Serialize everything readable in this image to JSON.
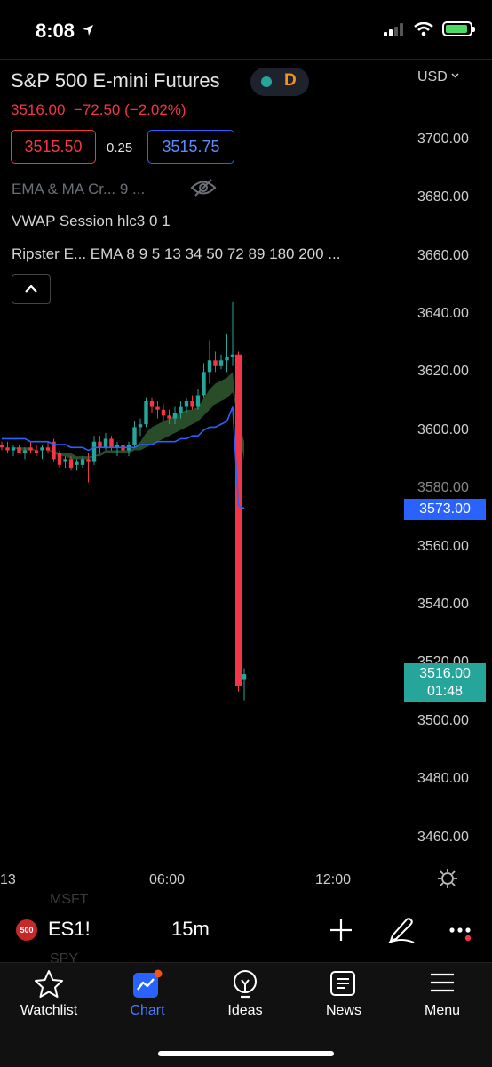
{
  "status": {
    "time": "8:08"
  },
  "header": {
    "symbol": "S&P 500 E-mini Futures",
    "interval_badge": "D",
    "currency": "USD",
    "last_price": "3516.00",
    "change": "−72.50 (−2.02%)",
    "bid": "3515.50",
    "spread": "0.25",
    "ask": "3515.75"
  },
  "indicators": [
    {
      "label": "EMA & MA Cr...   9 ..."
    },
    {
      "label": "VWAP Session hlc3 0 1"
    },
    {
      "label": "Ripster E...   EMA 8 9 5 13 34 50 72 89 180 200 ..."
    }
  ],
  "axis": {
    "y_ticks": [
      "3700.00",
      "3680.00",
      "3660.00",
      "3640.00",
      "3620.00",
      "3600.00",
      "3580.00",
      "3560.00",
      "3540.00",
      "3520.00",
      "3500.00",
      "3480.00",
      "3460.00"
    ],
    "x_ticks": [
      "13",
      "06:00",
      "12:00"
    ],
    "vwap_tag": "3573.00",
    "price_tag": "3516.00",
    "countdown": "01:48"
  },
  "toolbar": {
    "badge": "500",
    "ticker": "ES1!",
    "interval": "15m",
    "ghost_above": "MSFT",
    "ghost_below": "SPY"
  },
  "tabs": [
    {
      "id": "watchlist",
      "label": "Watchlist"
    },
    {
      "id": "chart",
      "label": "Chart"
    },
    {
      "id": "ideas",
      "label": "Ideas"
    },
    {
      "id": "news",
      "label": "News"
    },
    {
      "id": "menu",
      "label": "Menu"
    }
  ],
  "colors": {
    "up": "#26a69a",
    "down": "#f23645",
    "vwap": "#2962ff",
    "accent": "#2962ff"
  },
  "chart_data": {
    "type": "candlestick",
    "ylim": [
      3450,
      3710
    ],
    "y_ticks": [
      3700,
      3680,
      3660,
      3640,
      3620,
      3600,
      3580,
      3560,
      3540,
      3520,
      3500,
      3480,
      3460
    ],
    "x_ticks": [
      "13",
      "06:00",
      "12:00"
    ],
    "candles": [
      {
        "o": 3595,
        "h": 3596,
        "l": 3593,
        "c": 3594
      },
      {
        "o": 3594,
        "h": 3596,
        "l": 3592,
        "c": 3593
      },
      {
        "o": 3593,
        "h": 3595,
        "l": 3591,
        "c": 3594
      },
      {
        "o": 3594,
        "h": 3595,
        "l": 3592,
        "c": 3592
      },
      {
        "o": 3592,
        "h": 3594,
        "l": 3590,
        "c": 3593
      },
      {
        "o": 3594,
        "h": 3596,
        "l": 3592,
        "c": 3593
      },
      {
        "o": 3593,
        "h": 3595,
        "l": 3591,
        "c": 3592
      },
      {
        "o": 3593,
        "h": 3595,
        "l": 3590,
        "c": 3594
      },
      {
        "o": 3594,
        "h": 3596,
        "l": 3592,
        "c": 3593
      },
      {
        "o": 3596,
        "h": 3597,
        "l": 3589,
        "c": 3590
      },
      {
        "o": 3592,
        "h": 3593,
        "l": 3587,
        "c": 3588
      },
      {
        "o": 3589,
        "h": 3591,
        "l": 3587,
        "c": 3590
      },
      {
        "o": 3590,
        "h": 3591,
        "l": 3586,
        "c": 3587
      },
      {
        "o": 3588,
        "h": 3590,
        "l": 3586,
        "c": 3589
      },
      {
        "o": 3588,
        "h": 3591,
        "l": 3587,
        "c": 3590
      },
      {
        "o": 3590,
        "h": 3592,
        "l": 3582,
        "c": 3589
      },
      {
        "o": 3589,
        "h": 3598,
        "l": 3588,
        "c": 3596
      },
      {
        "o": 3596,
        "h": 3598,
        "l": 3592,
        "c": 3594
      },
      {
        "o": 3594,
        "h": 3599,
        "l": 3593,
        "c": 3597
      },
      {
        "o": 3597,
        "h": 3598,
        "l": 3593,
        "c": 3594
      },
      {
        "o": 3594,
        "h": 3596,
        "l": 3591,
        "c": 3595
      },
      {
        "o": 3595,
        "h": 3596,
        "l": 3592,
        "c": 3593
      },
      {
        "o": 3593,
        "h": 3596,
        "l": 3591,
        "c": 3595
      },
      {
        "o": 3595,
        "h": 3603,
        "l": 3594,
        "c": 3601
      },
      {
        "o": 3601,
        "h": 3604,
        "l": 3598,
        "c": 3602
      },
      {
        "o": 3602,
        "h": 3611,
        "l": 3601,
        "c": 3610
      },
      {
        "o": 3610,
        "h": 3611,
        "l": 3606,
        "c": 3608
      },
      {
        "o": 3608,
        "h": 3610,
        "l": 3604,
        "c": 3607
      },
      {
        "o": 3607,
        "h": 3609,
        "l": 3603,
        "c": 3605
      },
      {
        "o": 3605,
        "h": 3607,
        "l": 3602,
        "c": 3604
      },
      {
        "o": 3604,
        "h": 3608,
        "l": 3602,
        "c": 3606
      },
      {
        "o": 3606,
        "h": 3610,
        "l": 3604,
        "c": 3608
      },
      {
        "o": 3608,
        "h": 3611,
        "l": 3606,
        "c": 3610
      },
      {
        "o": 3610,
        "h": 3612,
        "l": 3607,
        "c": 3608
      },
      {
        "o": 3608,
        "h": 3614,
        "l": 3607,
        "c": 3612
      },
      {
        "o": 3612,
        "h": 3623,
        "l": 3611,
        "c": 3620
      },
      {
        "o": 3620,
        "h": 3631,
        "l": 3616,
        "c": 3624
      },
      {
        "o": 3624,
        "h": 3627,
        "l": 3620,
        "c": 3622
      },
      {
        "o": 3622,
        "h": 3626,
        "l": 3621,
        "c": 3624
      },
      {
        "o": 3624,
        "h": 3633,
        "l": 3620,
        "c": 3625
      },
      {
        "o": 3625,
        "h": 3644,
        "l": 3622,
        "c": 3626
      },
      {
        "o": 3626,
        "h": 3627,
        "l": 3510,
        "c": 3512
      },
      {
        "o": 3514,
        "h": 3518,
        "l": 3507,
        "c": 3516
      }
    ],
    "vwap": [
      3597,
      3597,
      3597,
      3597,
      3597,
      3596,
      3596,
      3596,
      3596,
      3595,
      3595,
      3595,
      3594,
      3594,
      3594,
      3593,
      3594,
      3594,
      3594,
      3594,
      3594,
      3594,
      3594,
      3594,
      3595,
      3595,
      3595,
      3596,
      3596,
      3596,
      3596,
      3597,
      3597,
      3598,
      3598,
      3600,
      3601,
      3601,
      3602,
      3603,
      3608,
      3574,
      3573
    ],
    "ema_fast": [
      3594,
      3594,
      3594,
      3593,
      3593,
      3593,
      3593,
      3593,
      3593,
      3592,
      3591,
      3591,
      3590,
      3590,
      3590,
      3590,
      3591,
      3592,
      3593,
      3593,
      3593,
      3593,
      3593,
      3594,
      3596,
      3599,
      3601,
      3602,
      3603,
      3604,
      3605,
      3606,
      3607,
      3607,
      3608,
      3611,
      3614,
      3616,
      3617,
      3618,
      3620,
      3600,
      3590
    ],
    "ema_slow": [
      3594,
      3594,
      3594,
      3594,
      3594,
      3594,
      3593,
      3593,
      3593,
      3593,
      3592,
      3592,
      3592,
      3591,
      3591,
      3591,
      3591,
      3591,
      3592,
      3592,
      3592,
      3592,
      3592,
      3593,
      3593,
      3594,
      3595,
      3596,
      3597,
      3598,
      3599,
      3600,
      3601,
      3602,
      3603,
      3605,
      3607,
      3609,
      3610,
      3611,
      3613,
      3604,
      3596
    ]
  }
}
